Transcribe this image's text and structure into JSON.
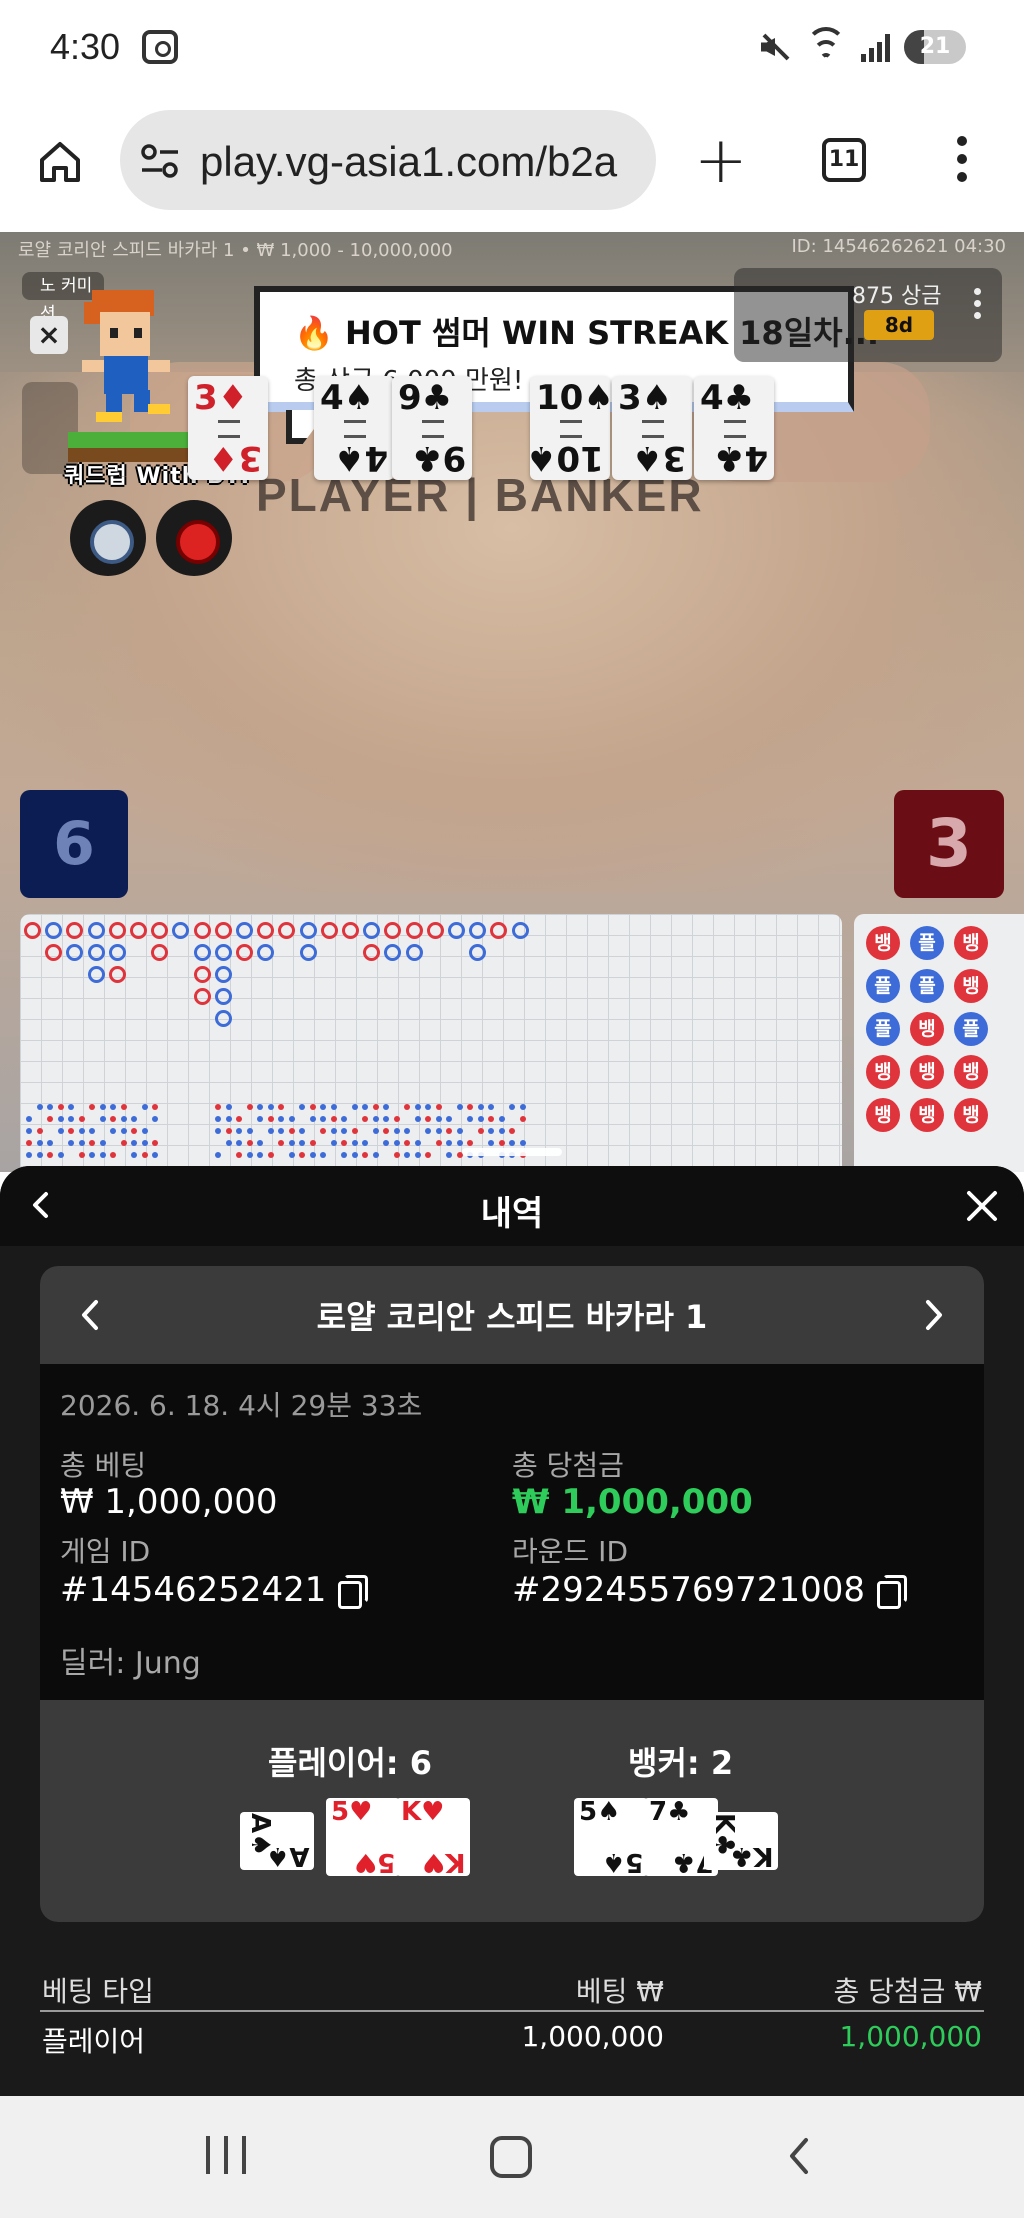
{
  "status_bar": {
    "time": "4:30",
    "battery": "21",
    "icons": [
      "screenshot-icon",
      "mute-icon",
      "wifi-icon",
      "signal-icon",
      "battery-icon"
    ]
  },
  "browser": {
    "url": "play.vg-asia1.com/b2a",
    "tab_count": "11",
    "icons": [
      "home-icon",
      "site-settings-icon",
      "new-tab-plus-icon",
      "tab-switcher-icon",
      "more-vertical-icon"
    ]
  },
  "game_view": {
    "table_info": "로얄 코리안 스피드 바카라 1 • ₩ 1,000 - 10,000,000",
    "table_id": "ID: 14546262621 04:30",
    "commission_label": "노 커미션",
    "mascot_label": "쿼드럽 With BTI",
    "promo": {
      "title": "🔥 HOT 썸머 WIN STREAK 18일차...",
      "subtitle": "총 상금 6,000 만원!"
    },
    "prize_box": {
      "text": "875 상금",
      "badge": "8d"
    },
    "table_label": "PLAYER | BANKER",
    "player_cards": [
      {
        "rank": "3",
        "suit": "♦",
        "red": true
      },
      {
        "rank": "4",
        "suit": "♠",
        "red": false
      },
      {
        "rank": "9",
        "suit": "♣",
        "red": false
      }
    ],
    "banker_cards": [
      {
        "rank": "10",
        "suit": "♠",
        "red": false
      },
      {
        "rank": "3",
        "suit": "♠",
        "red": false
      },
      {
        "rank": "4",
        "suit": "♣",
        "red": false
      }
    ],
    "player_score": "6",
    "banker_score": "3",
    "big_eye_labels": [
      "뱅",
      "플",
      "뱅",
      "플",
      "플",
      "뱅",
      "플",
      "뱅",
      "플",
      "뱅",
      "뱅",
      "뱅",
      "뱅",
      "뱅",
      "뱅"
    ],
    "colors": {
      "player": "#3d6bd8",
      "banker": "#e0343c"
    }
  },
  "history_sheet": {
    "title": "내역",
    "game_name": "로얄 코리안 스피드 바카라 1",
    "datetime": "2026. 6. 18. 4시 29분 33초",
    "total_bet_label": "총 베팅",
    "total_bet_value": "₩ 1,000,000",
    "total_win_label": "총 당첨금",
    "total_win_value": "₩ 1,000,000",
    "game_id_label": "게임 ID",
    "game_id_value": "#14546252421",
    "round_id_label": "라운드 ID",
    "round_id_value": "#292455769721008",
    "dealer": "딜러: Jung",
    "player_result": "플레이어: 6",
    "banker_result": "뱅커: 2",
    "player_cards": [
      {
        "rank": "A",
        "suit": "♠",
        "red": false,
        "sideways": true
      },
      {
        "rank": "5",
        "suit": "♥",
        "red": true,
        "sideways": false
      },
      {
        "rank": "K",
        "suit": "♥",
        "red": true,
        "sideways": false
      }
    ],
    "banker_cards": [
      {
        "rank": "5",
        "suit": "♠",
        "red": false,
        "sideways": false
      },
      {
        "rank": "7",
        "suit": "♣",
        "red": false,
        "sideways": false
      },
      {
        "rank": "K",
        "suit": "♣",
        "red": false,
        "sideways": true
      }
    ],
    "bet_table": {
      "headers": [
        "베팅 타입",
        "베팅 ₩",
        "총 당첨금 ₩"
      ],
      "rows": [
        {
          "type": "플레이어",
          "bet": "1,000,000",
          "win": "1,000,000"
        }
      ]
    },
    "accent_green": "#2ecc5a"
  },
  "nav_bar": {
    "icons": [
      "recent-apps-icon",
      "home-icon",
      "back-icon"
    ]
  }
}
